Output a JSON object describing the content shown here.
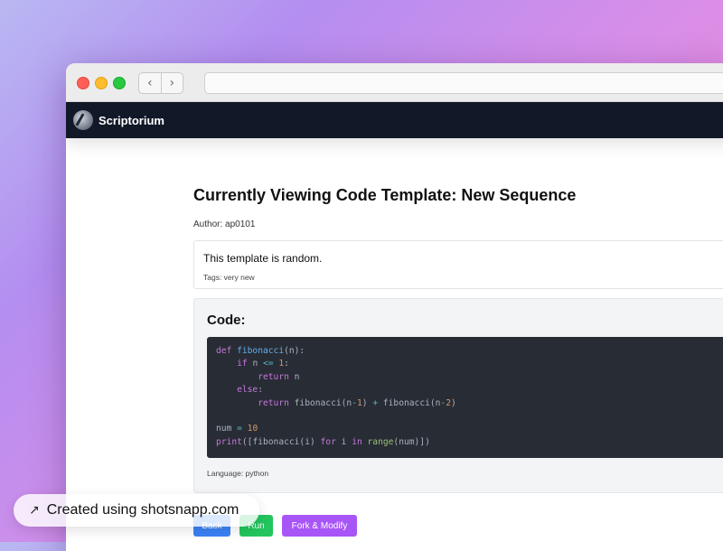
{
  "app": {
    "brand": "Scriptorium"
  },
  "browser": {
    "back_icon": "‹",
    "forward_icon": "›"
  },
  "template": {
    "title": "Currently Viewing Code Template: New Sequence",
    "author": "Author: ap0101",
    "description": "This template is random.",
    "tags": "Tags: very new",
    "code_heading": "Code:",
    "language": "Language: python",
    "code_lines": [
      [
        [
          "kw",
          "def "
        ],
        [
          "fn",
          "fibonacci"
        ],
        [
          "",
          "(n):"
        ]
      ],
      [
        [
          "",
          "    "
        ],
        [
          "kw",
          "if "
        ],
        [
          "",
          "n "
        ],
        [
          "op",
          "<="
        ],
        [
          "num",
          " 1"
        ],
        [
          "",
          ":"
        ]
      ],
      [
        [
          "",
          "        "
        ],
        [
          "kw",
          "return "
        ],
        [
          "",
          "n"
        ]
      ],
      [
        [
          "",
          "    "
        ],
        [
          "kw",
          "else"
        ],
        [
          "",
          ":"
        ]
      ],
      [
        [
          "",
          "        "
        ],
        [
          "kw",
          "return "
        ],
        [
          "",
          "fibonacci(n"
        ],
        [
          "op",
          "-"
        ],
        [
          "num",
          "1"
        ],
        [
          "",
          ") "
        ],
        [
          "op",
          "+"
        ],
        [
          "",
          " fibonacci(n"
        ],
        [
          "op",
          "-"
        ],
        [
          "num",
          "2"
        ],
        [
          "",
          ")"
        ]
      ],
      [
        [
          "",
          ""
        ]
      ],
      [
        [
          "",
          "num "
        ],
        [
          "op",
          "="
        ],
        [
          "num",
          " 10"
        ]
      ],
      [
        [
          "kw",
          "print"
        ],
        [
          "",
          "([fibonacci(i) "
        ],
        [
          "kw",
          "for "
        ],
        [
          "",
          "i "
        ],
        [
          "kw",
          "in "
        ],
        [
          "bi",
          "range"
        ],
        [
          "",
          "(num)])"
        ]
      ]
    ]
  },
  "actions": {
    "back": "Back",
    "run": "Run",
    "fork": "Fork & Modify"
  },
  "toast": {
    "icon": "↗",
    "text": "Created using shotsnapp.com"
  },
  "colors": {
    "nav_bg": "#111827",
    "code_bg": "#282c34",
    "back": "#3b82f6",
    "run": "#22c55e",
    "fork": "#a855f7"
  }
}
